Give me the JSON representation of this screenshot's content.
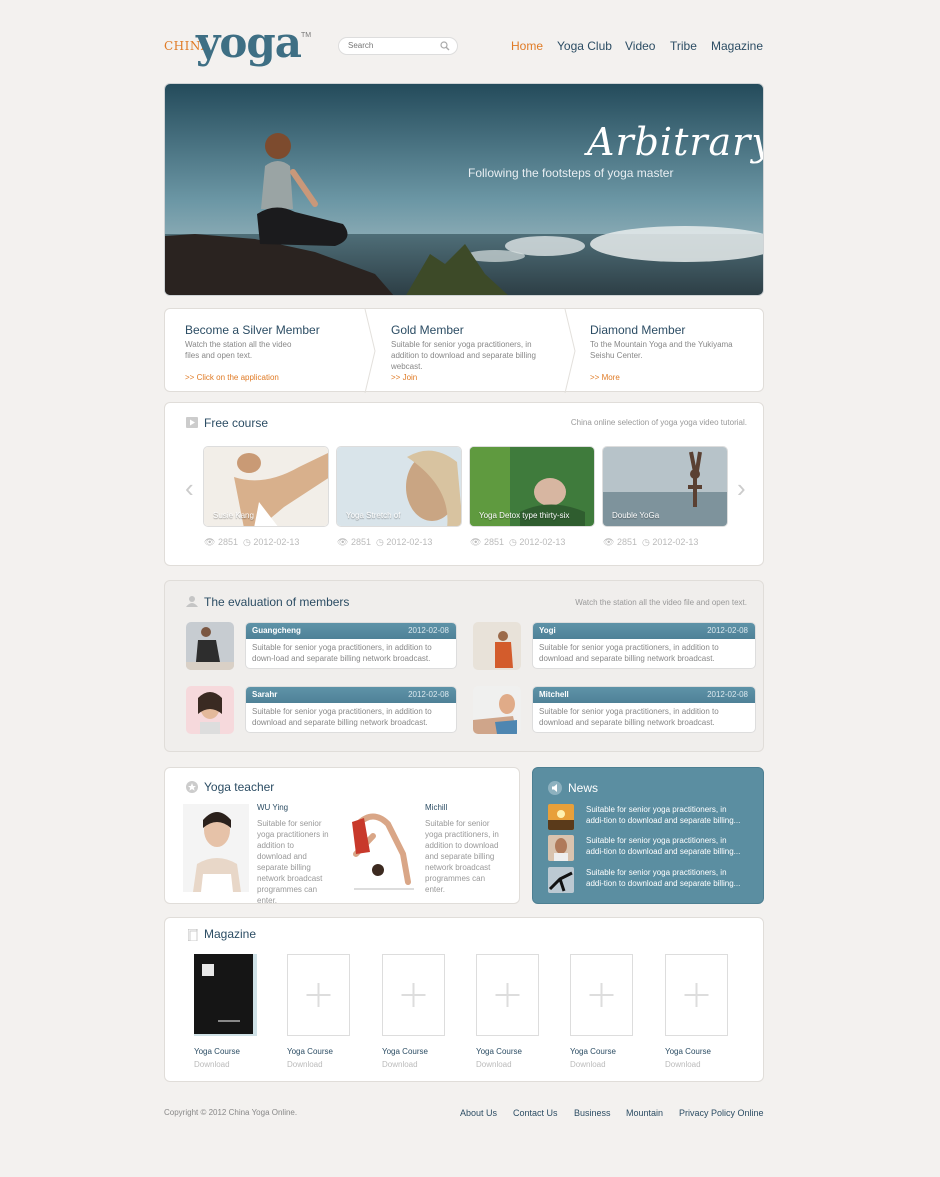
{
  "header": {
    "logo_prefix": "CHINA",
    "logo_main": "yoga",
    "logo_tm": "TM",
    "search_placeholder": "Search",
    "nav": [
      "Home",
      "Yoga Club",
      "Video",
      "Tribe",
      "Magazine"
    ]
  },
  "hero": {
    "title": "Arbitrary",
    "subtitle": "Following the footsteps of yoga master"
  },
  "membership": [
    {
      "title": "Become a Silver Member",
      "desc": "Watch the station all the video files and open text.",
      "link": ">> Click on the application"
    },
    {
      "title": "Gold Member",
      "desc": "Suitable for senior yoga practitioners, in addition to download and separate billing webcast.",
      "link": ">> Join"
    },
    {
      "title": "Diamond Member",
      "desc": "To the Mountain Yoga and the Yukiyama Seishu Center.",
      "link": ">> More"
    }
  ],
  "free_course": {
    "title": "Free course",
    "right_text": "China online selection of yoga yoga video tutorial.",
    "items": [
      {
        "caption": "Susie Kang",
        "views": "2851",
        "date": "2012-02-13"
      },
      {
        "caption": "Yoga Stretch of",
        "views": "2851",
        "date": "2012-02-13"
      },
      {
        "caption": "Yoga Detox type thirty-six",
        "views": "2851",
        "date": "2012-02-13"
      },
      {
        "caption": "Double YoGa",
        "views": "2851",
        "date": "2012-02-13"
      }
    ]
  },
  "evaluation": {
    "title": "The evaluation of members",
    "right_text": "Watch the station all the video file and open text.",
    "reviews": [
      {
        "name": "Guangcheng",
        "date": "2012-02-08",
        "text": "Suitable for senior yoga practitioners, in addition to down-load and separate billing network broadcast."
      },
      {
        "name": "Yogi",
        "date": "2012-02-08",
        "text": "Suitable for senior yoga practitioners, in addition to download and separate billing network broadcast."
      },
      {
        "name": "Sarahr",
        "date": "2012-02-08",
        "text": "Suitable for senior yoga practitioners, in addition to download and separate billing network broadcast."
      },
      {
        "name": "Mitchell",
        "date": "2012-02-08",
        "text": "Suitable for senior yoga practitioners, in addition to download and separate billing network broadcast."
      }
    ]
  },
  "teachers": {
    "title": "Yoga teacher",
    "items": [
      {
        "name": "WU Ying",
        "desc": "Suitable for senior yoga practitioners in addition to download and separate billing network broadcast programmes can enter."
      },
      {
        "name": "Michill",
        "desc": "Suitable for senior yoga practitioners, in addition to download and separate billing network broadcast programmes can enter."
      }
    ]
  },
  "news": {
    "title": "News",
    "items": [
      "Suitable for senior yoga practitioners, in addi-tion to download and separate billing...",
      "Suitable for senior yoga practitioners, in addi-tion to download and separate billing...",
      "Suitable for senior yoga practitioners, in addi-tion to download and separate billing..."
    ]
  },
  "magazine": {
    "title": "Magazine",
    "items": [
      {
        "title": "Yoga Course",
        "action": "Download"
      },
      {
        "title": "Yoga Course",
        "action": "Download"
      },
      {
        "title": "Yoga Course",
        "action": "Download"
      },
      {
        "title": "Yoga Course",
        "action": "Download"
      },
      {
        "title": "Yoga Course",
        "action": "Download"
      },
      {
        "title": "Yoga Course",
        "action": "Download"
      }
    ]
  },
  "footer": {
    "copyright": "Copyright © 2012 China Yoga Online.",
    "links": [
      "About Us",
      "Contact Us",
      "Business",
      "Mountain",
      "Privacy Policy Online"
    ]
  },
  "colors": {
    "accent": "#e07b26",
    "primary": "#2c4d64",
    "teal": "#5b8ea1"
  }
}
